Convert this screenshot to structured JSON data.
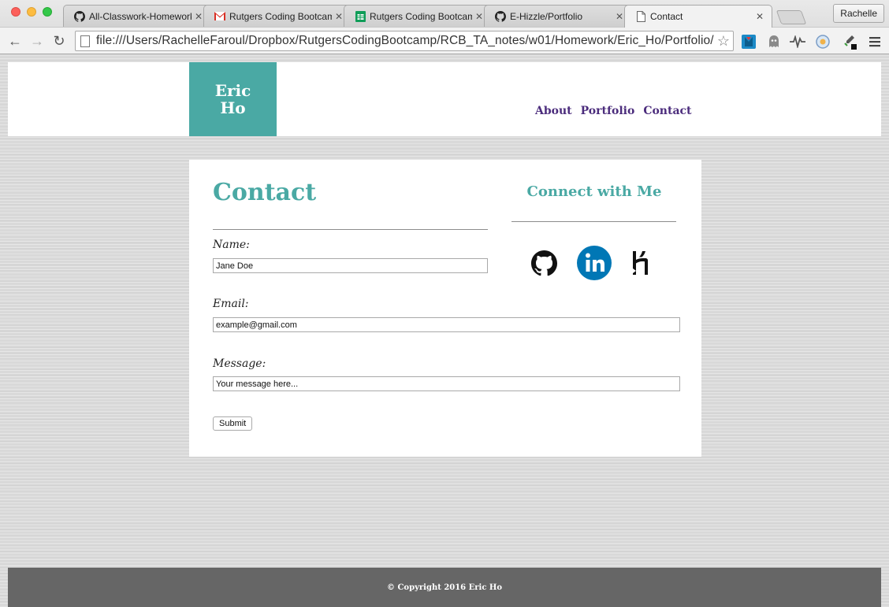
{
  "browser": {
    "tabs": [
      {
        "title": "All-Classwork-Homework",
        "icon": "github-icon"
      },
      {
        "title": "Rutgers Coding Bootcamp",
        "icon": "gmail-icon"
      },
      {
        "title": "Rutgers Coding Bootcamp",
        "icon": "sheets-icon"
      },
      {
        "title": "E-Hizzle/Portfolio",
        "icon": "github-icon"
      },
      {
        "title": "Contact",
        "icon": "page-icon",
        "active": true
      }
    ],
    "profile": "Rachelle",
    "url": "file:///Users/RachelleFaroul/Dropbox/RutgersCodingBootcamp/RCB_TA_notes/w01/Homework/Eric_Ho/Portfolio/con…"
  },
  "header": {
    "logo_line1": "Eric",
    "logo_line2": "Ho",
    "nav": [
      "About",
      "Portfolio",
      "Contact"
    ]
  },
  "contact": {
    "heading": "Contact",
    "connect_heading": "Connect with Me",
    "name_label": "Name:",
    "name_value": "Jane Doe",
    "email_label": "Email:",
    "email_value": "example@gmail.com",
    "message_label": "Message:",
    "message_value": "Your message here...",
    "submit_label": "Submit",
    "socials": [
      "github-icon",
      "linkedin-icon",
      "heroku-icon"
    ]
  },
  "footer": {
    "copyright": "© Copyright 2016 Eric Ho"
  },
  "colors": {
    "accent": "#4aa9a4",
    "nav": "#4b2c7c",
    "footer": "#666666",
    "linkedin": "#0077b5"
  }
}
